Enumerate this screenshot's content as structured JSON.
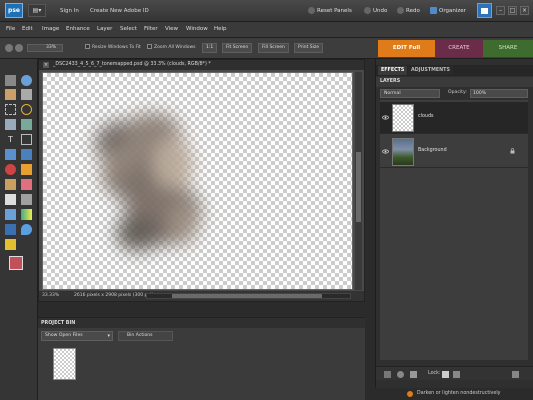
{
  "titlebar": {
    "logo": "pse",
    "workspace_button": "▤▾",
    "sign_in": "Sign In",
    "create_id": "Create New Adobe ID",
    "reset_panels": "Reset Panels",
    "undo": "Undo",
    "redo": "Redo",
    "organizer": "Organizer",
    "window_controls": [
      "–",
      "□",
      "×"
    ]
  },
  "menu": [
    "File",
    "Edit",
    "Image",
    "Enhance",
    "Layer",
    "Select",
    "Filter",
    "View",
    "Window",
    "Help"
  ],
  "options": {
    "zoom_value": "33%",
    "resize_windows": "Resize Windows To Fit",
    "zoom_all_windows": "Zoom All Windows",
    "one_to_one": "1:1",
    "fit_screen": "Fit Screen",
    "fill_screen": "Fill Screen",
    "print_size": "Print Size"
  },
  "mode_tabs": {
    "edit": "EDIT Full",
    "create": "CREATE",
    "share": "SHARE"
  },
  "document": {
    "title": "_DSC2433_4_5_6_7_tonemapped.psd @ 33.3% (clouds, RGB/8*) *",
    "close": "×",
    "zoom": "33.33%",
    "dimensions": "2616 pixels x 2908 pixels (300 ppi)"
  },
  "project_bin": {
    "title": "PROJECT BIN",
    "show": "Show Open Files",
    "actions": "Bin Actions"
  },
  "panel": {
    "tabs": [
      "EFFECTS",
      "ADJUSTMENTS"
    ],
    "layers_title": "LAYERS",
    "blend_mode": "Normal",
    "opacity_label": "Opacity:",
    "opacity_value": "100%",
    "layers": [
      {
        "name": "clouds",
        "selected": true
      },
      {
        "name": "Background",
        "selected": false
      }
    ],
    "lock_label": "Lock:"
  },
  "status": {
    "hint": "Darken or lighten nondestructively"
  },
  "colors": {
    "edit_accent": "#e07b1a",
    "create_tab": "#6b2c4a",
    "share_tab": "#3e6b2e",
    "foreground_swatch": "#c0505a",
    "background_swatch": "#ffffff"
  }
}
